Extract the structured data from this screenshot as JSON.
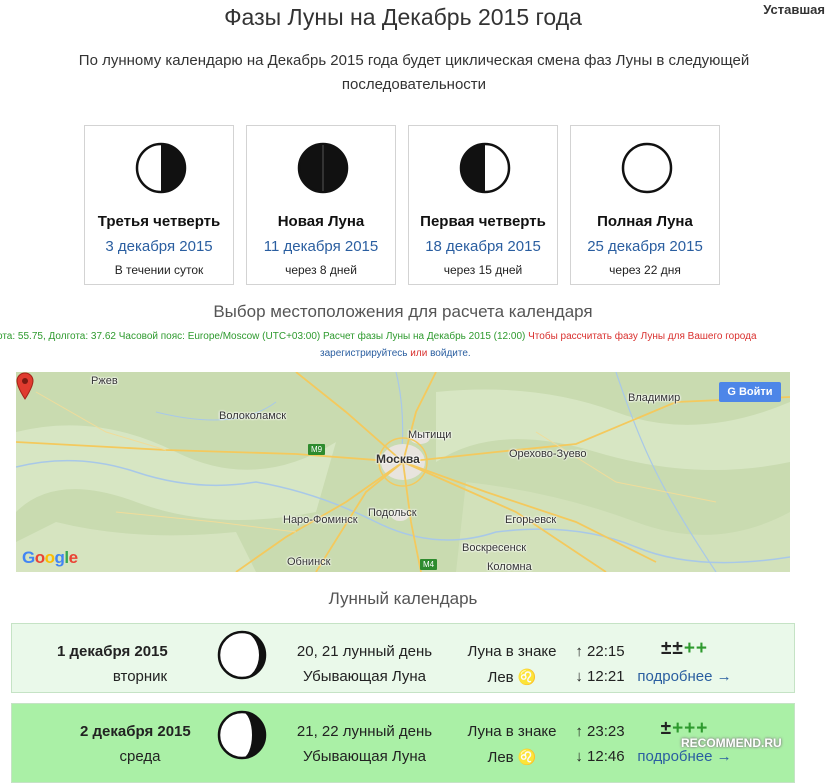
{
  "header": {
    "user_label": "Уставшая",
    "title": "Фазы Луны на Декабрь 2015 года",
    "intro_line1": "По лунному календарю на Декабрь 2015 года будет циклическая смена фаз Луны в следующей",
    "intro_line2": "последовательности"
  },
  "phases": [
    {
      "name": "Третья четверть",
      "date": "3 декабря 2015",
      "note": "В течении суток",
      "icon": "last-quarter-moon-icon"
    },
    {
      "name": "Новая Луна",
      "date": "11 декабря 2015",
      "note": "через 8 дней",
      "icon": "new-moon-icon"
    },
    {
      "name": "Первая четверть",
      "date": "18 декабря 2015",
      "note": "через 15 дней",
      "icon": "first-quarter-moon-icon"
    },
    {
      "name": "Полная Луна",
      "date": "25 декабря 2015",
      "note": "через 22 дня",
      "icon": "full-moon-icon"
    }
  ],
  "location": {
    "heading": "Выбор местоположения для расчета календаря",
    "info_green": "ота: 55.75, Долгота: 37.62 Часовой пояс: Europe/Moscow (UTC+03:00) Расчет фазы Луны на Декабрь 2015 (12:00) ",
    "info_red": "Чтобы рассчитать фазу Луны для Вашего города",
    "register_link": "зарегистрируйтесь",
    "or_text": " или ",
    "login_link": "войдите",
    "period": "."
  },
  "map": {
    "login_button": "Войти",
    "login_button_icon": "G",
    "google_logo": "Google",
    "cities": [
      "Ржев",
      "Волоколамск",
      "Мытищи",
      "Москва",
      "Орехово-Зуево",
      "Владимир",
      "Наро-Фоминск",
      "Подольск",
      "Егорьевск",
      "Воскресенск",
      "Обнинск",
      "Коломна"
    ],
    "roads": [
      "M9",
      "M4"
    ],
    "colors": {
      "land": "#c9dbb0",
      "road": "#f4c95d",
      "water": "#a8c8e8",
      "city": "#e8e4de"
    }
  },
  "calendar": {
    "heading": "Лунный календарь",
    "rows": [
      {
        "date": "1 декабря 2015",
        "weekday": "вторник",
        "lunar_day": "20, 21 лунный день",
        "phase": "Убывающая Луна",
        "sign_label": "Луна в знаке",
        "sign": "Лев ♌",
        "rise": "↑ 22:15",
        "set": "↓ 12:21",
        "marks_pm": "±±",
        "marks_plus": "++",
        "more_link": "подробнее →",
        "bg": "#eaf9ea"
      },
      {
        "date": "2 декабря 2015",
        "weekday": "среда",
        "lunar_day": "21, 22 лунный день",
        "phase": "Убывающая Луна",
        "sign_label": "Луна в знаке",
        "sign": "Лев ♌",
        "rise": "↑ 23:23",
        "set": "↓ 12:46",
        "marks_pm": "±",
        "marks_plus": "+++",
        "more_link": "подробнее →",
        "bg": "#aaf0a6"
      }
    ]
  },
  "watermark": "RECOMMEND.RU"
}
